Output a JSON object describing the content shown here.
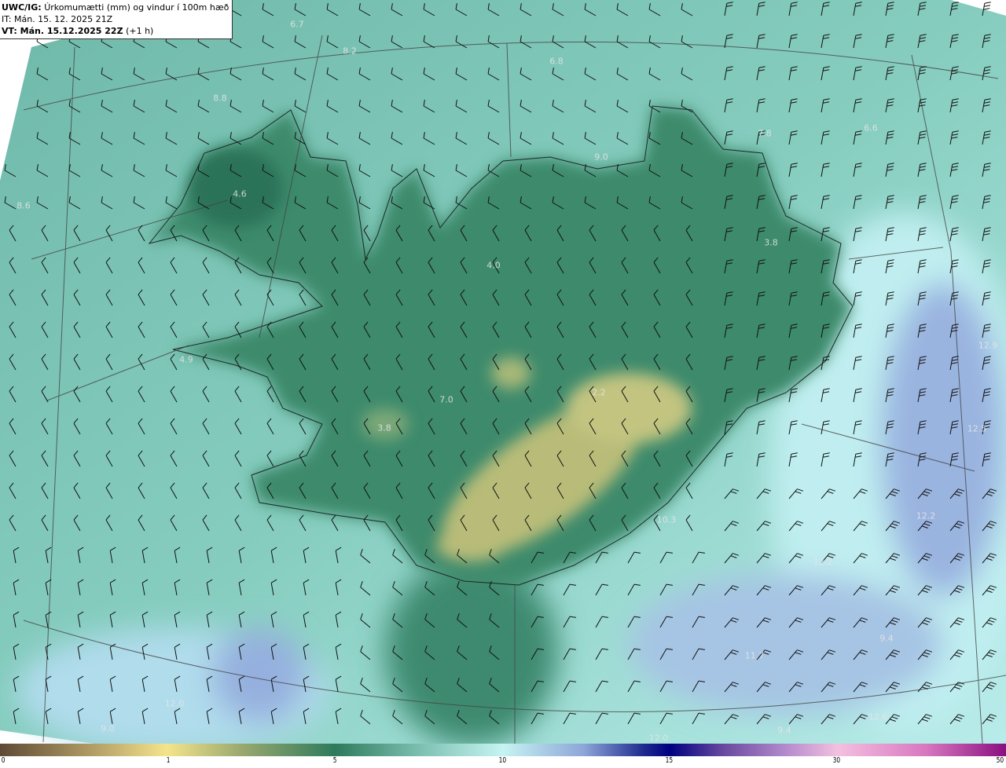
{
  "header": {
    "model_label": "UWC/IG:",
    "title": "Úrkomumætti (mm) og vindur í 100m hæð",
    "init_time": "IT: Mán. 15. 12. 2025 21Z",
    "valid_label": "VT: Mán. 15.12.2025 22Z",
    "valid_offset": "(+1 h)"
  },
  "map_labels": [
    "6.7",
    "8.2",
    "6.8",
    "8.8",
    "7.8",
    "6.6",
    "8.6",
    "4.6",
    "9.0",
    "4.0",
    "3.8",
    "4.9",
    "7.0",
    "3.8",
    "2.2",
    "12.9",
    "12.5",
    "10.3",
    "12.2",
    "12.2",
    "9.4",
    "11.7",
    "12.0",
    "9.0",
    "12.6",
    "9.4",
    "12.0"
  ],
  "colorbar": {
    "unit": "mm",
    "ticks": [
      "0",
      "1",
      "5",
      "10",
      "15",
      "30",
      "50"
    ]
  },
  "colors": {
    "land_green": "#2e7a5c",
    "sea_teal": "#8fd0c4",
    "heavy_blue": "#8ea6d8",
    "light_yellow": "#d8d88a"
  }
}
